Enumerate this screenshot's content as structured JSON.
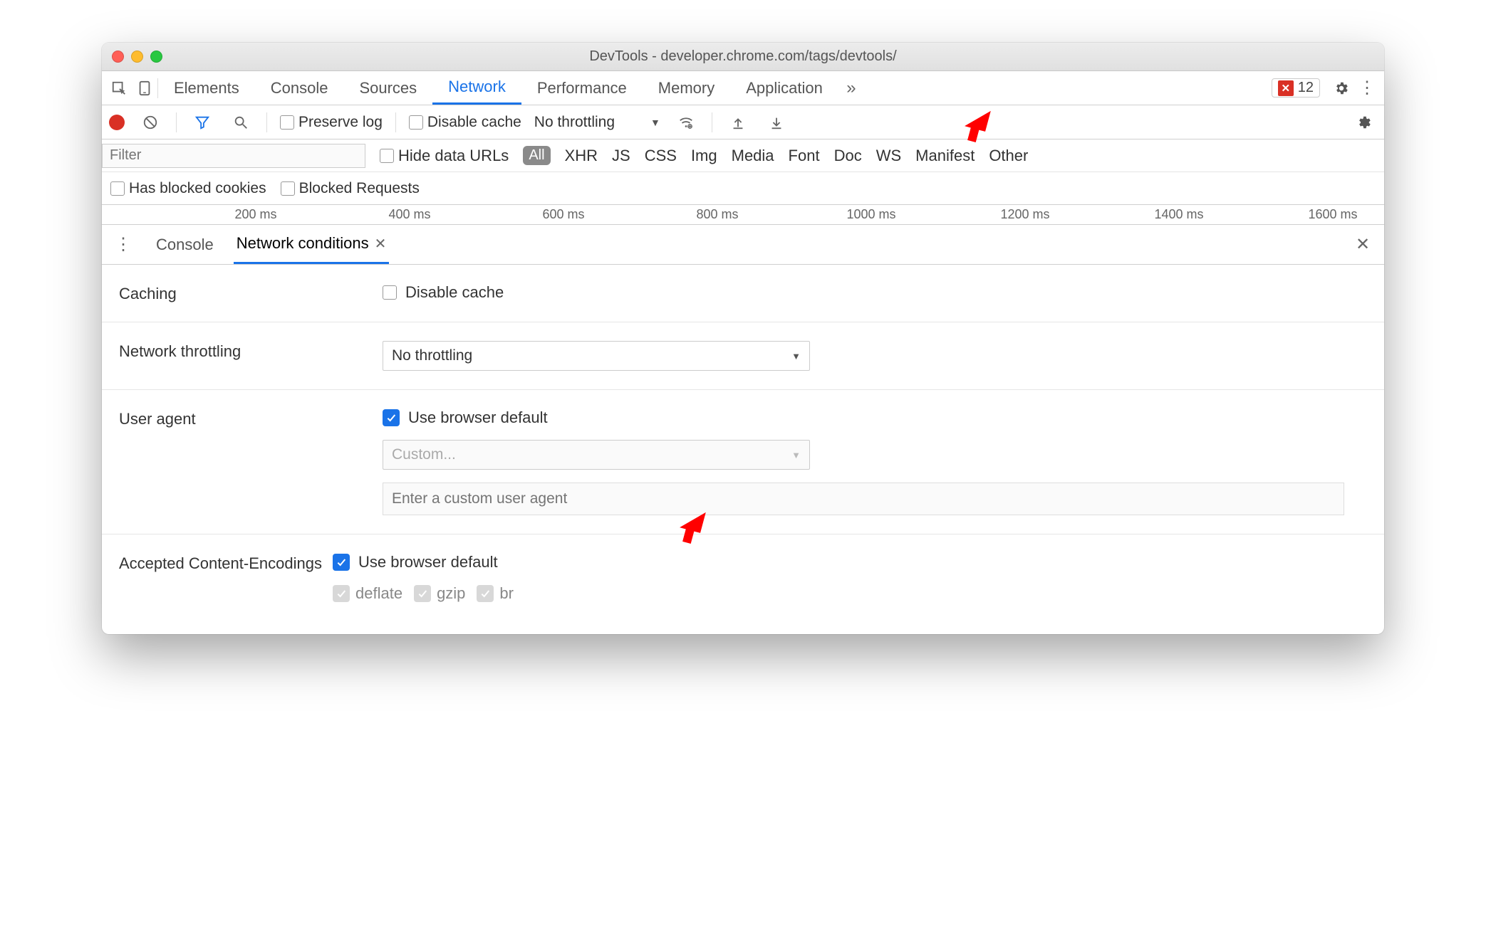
{
  "window": {
    "title": "DevTools - developer.chrome.com/tags/devtools/"
  },
  "tabs": {
    "items": [
      "Elements",
      "Console",
      "Sources",
      "Network",
      "Performance",
      "Memory",
      "Application"
    ],
    "active": "Network",
    "errors_count": "12"
  },
  "net_toolbar": {
    "preserve_log": "Preserve log",
    "disable_cache": "Disable cache",
    "throttling": "No throttling"
  },
  "filter": {
    "placeholder": "Filter",
    "hide_data_urls": "Hide data URLs",
    "all_pill": "All",
    "types": [
      "XHR",
      "JS",
      "CSS",
      "Img",
      "Media",
      "Font",
      "Doc",
      "WS",
      "Manifest",
      "Other"
    ]
  },
  "filter2": {
    "blocked_cookies": "Has blocked cookies",
    "blocked_requests": "Blocked Requests"
  },
  "ruler": {
    "ticks": [
      "200 ms",
      "400 ms",
      "600 ms",
      "800 ms",
      "1000 ms",
      "1200 ms",
      "1400 ms",
      "1600 ms"
    ]
  },
  "drawer": {
    "kebab": "⋮",
    "tabs": {
      "console": "Console",
      "netcond": "Network conditions"
    },
    "caching": {
      "label": "Caching",
      "disable_cache": "Disable cache"
    },
    "throttling": {
      "label": "Network throttling",
      "value": "No throttling"
    },
    "useragent": {
      "label": "User agent",
      "use_default": "Use browser default",
      "custom_placeholder": "Custom...",
      "enter_ua_placeholder": "Enter a custom user agent"
    },
    "encodings": {
      "label": "Accepted Content-Encodings",
      "use_default": "Use browser default",
      "items": [
        "deflate",
        "gzip",
        "br"
      ]
    }
  }
}
